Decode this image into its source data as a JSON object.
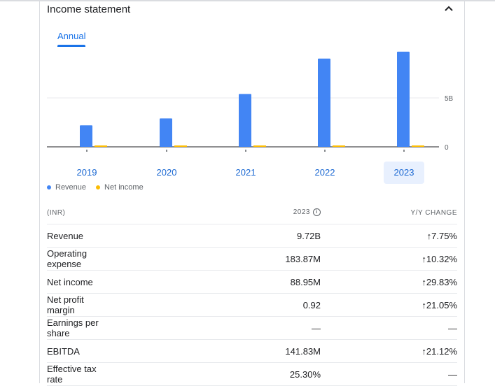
{
  "card": {
    "title": "Income statement",
    "collapse_icon": "chevron-up-icon",
    "tab_annual": "Annual"
  },
  "chart_data": {
    "type": "bar",
    "categories": [
      "2019",
      "2020",
      "2021",
      "2022",
      "2023"
    ],
    "series": [
      {
        "name": "Revenue",
        "color": "#4285f4",
        "values": [
          2.2,
          2.9,
          5.4,
          9.02,
          9.72
        ]
      },
      {
        "name": "Net income",
        "color": "#fbbc04",
        "values": [
          0.03,
          0.03,
          0.04,
          0.069,
          0.089
        ]
      }
    ],
    "y_ticks": [
      "0",
      "5B"
    ],
    "selected_category": "2023",
    "ylim": [
      0,
      10
    ]
  },
  "legend": {
    "revenue": "Revenue",
    "net_income": "Net income"
  },
  "table": {
    "headers": {
      "metric": "(INR)",
      "year": "2023",
      "change": "Y/Y CHANGE"
    },
    "rows": [
      {
        "label": "Revenue",
        "value": "9.72B",
        "change": "7.75%",
        "arrow": "↑"
      },
      {
        "label": "Operating expense",
        "value": "183.87M",
        "change": "10.32%",
        "arrow": "↑"
      },
      {
        "label": "Net income",
        "value": "88.95M",
        "change": "29.83%",
        "arrow": "↑"
      },
      {
        "label": "Net profit margin",
        "value": "0.92",
        "change": "21.05%",
        "arrow": "↑"
      },
      {
        "label": "Earnings per share",
        "value": "—",
        "change": "—",
        "arrow": ""
      },
      {
        "label": "EBITDA",
        "value": "141.83M",
        "change": "21.12%",
        "arrow": "↑"
      },
      {
        "label": "Effective tax rate",
        "value": "25.30%",
        "change": "—",
        "arrow": ""
      }
    ]
  }
}
